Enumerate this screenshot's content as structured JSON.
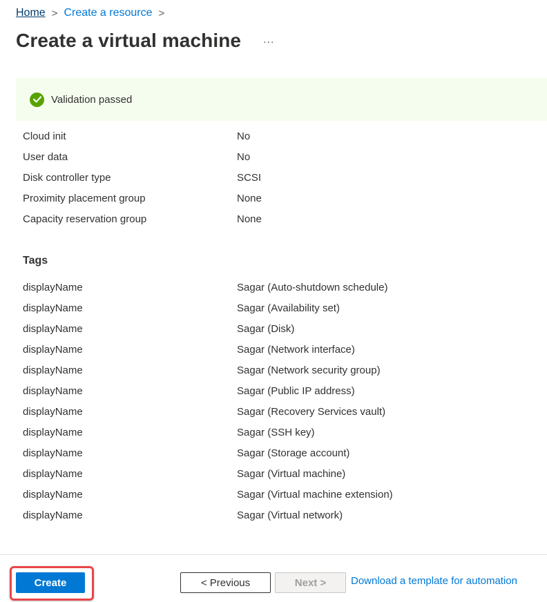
{
  "breadcrumb": {
    "items": [
      {
        "label": "Home"
      },
      {
        "label": "Create a resource"
      }
    ],
    "separator": ">"
  },
  "header": {
    "title": "Create a virtual machine",
    "more_label": "..."
  },
  "banner": {
    "icon": "check-circle-icon",
    "text": "Validation passed",
    "color": "#57a300",
    "background": "#f5fdef"
  },
  "details": [
    {
      "label": "Cloud init",
      "value": "No"
    },
    {
      "label": "User data",
      "value": "No"
    },
    {
      "label": "Disk controller type",
      "value": "SCSI"
    },
    {
      "label": "Proximity placement group",
      "value": "None"
    },
    {
      "label": "Capacity reservation group",
      "value": "None"
    }
  ],
  "tags": {
    "title": "Tags",
    "items": [
      {
        "name": "displayName",
        "value": "Sagar (Auto-shutdown schedule)"
      },
      {
        "name": "displayName",
        "value": "Sagar (Availability set)"
      },
      {
        "name": "displayName",
        "value": "Sagar (Disk)"
      },
      {
        "name": "displayName",
        "value": "Sagar (Network interface)"
      },
      {
        "name": "displayName",
        "value": "Sagar (Network security group)"
      },
      {
        "name": "displayName",
        "value": "Sagar (Public IP address)"
      },
      {
        "name": "displayName",
        "value": "Sagar (Recovery Services vault)"
      },
      {
        "name": "displayName",
        "value": "Sagar (SSH key)"
      },
      {
        "name": "displayName",
        "value": "Sagar (Storage account)"
      },
      {
        "name": "displayName",
        "value": "Sagar (Virtual machine)"
      },
      {
        "name": "displayName",
        "value": "Sagar (Virtual machine extension)"
      },
      {
        "name": "displayName",
        "value": "Sagar (Virtual network)"
      }
    ]
  },
  "footer": {
    "create_label": "Create",
    "previous_label": "< Previous",
    "next_label": "Next >",
    "template_link": "Download a template for automation",
    "accent": "#0078d4",
    "highlight_color": "#e8454a"
  }
}
